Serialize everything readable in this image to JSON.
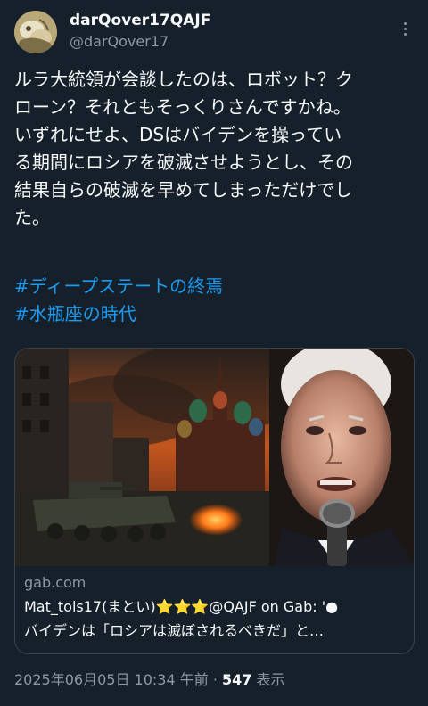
{
  "author": {
    "display_name": "darQover17QAJF",
    "handle": "@darQover17",
    "avatar_icon": "avatar-image"
  },
  "more_icon": "more-options-icon",
  "tweet": {
    "text": "ルラ大統領が会談したのは、ロボット？ク\nローン？それともそっくりさんですかね。\nいずれにせよ、DSはバイデンを操ってい\nる期間にロシアを破滅させようとし、その\n結果自らの破滅を早めてしまっただけでし\nた。",
    "hashtags": [
      "#ディープステートの終焉",
      "#水瓶座の時代"
    ]
  },
  "card": {
    "domain": "gab.com",
    "title": "Mat_tois17(まとい)⭐⭐⭐@QAJF on Gab: '●",
    "description": "バイデンは「ロシアは滅ぼされるべきだ」と…"
  },
  "meta": {
    "timestamp": "2025年06月05日 10:34 午前",
    "separator": " · ",
    "views_count": "547",
    "views_label": " 表示"
  },
  "colors": {
    "background": "#15202b",
    "text": "#f7f9f9",
    "secondary": "#8b98a5",
    "link": "#1d9bf0",
    "border": "#38444d"
  }
}
